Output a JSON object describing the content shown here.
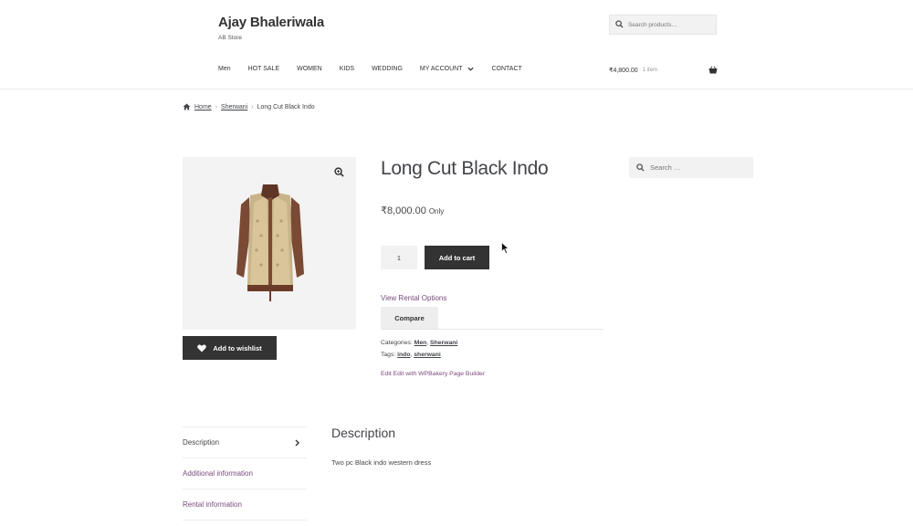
{
  "site": {
    "title": "Ajay Bhaleriwala",
    "tagline": "AB Store"
  },
  "header_search": {
    "placeholder": "Search products…"
  },
  "nav": {
    "items": [
      {
        "label": "Men"
      },
      {
        "label": "HOT SALE"
      },
      {
        "label": "WOMEN"
      },
      {
        "label": "KIDS"
      },
      {
        "label": "WEDDING"
      },
      {
        "label": "MY ACCOUNT"
      },
      {
        "label": "CONTACT"
      }
    ]
  },
  "cart": {
    "amount": "₹4,800.00",
    "count": "1 item"
  },
  "breadcrumb": {
    "home": "Home",
    "category": "Sherwani",
    "current": "Long Cut Black Indo"
  },
  "product": {
    "title": "Long Cut Black Indo",
    "price": "₹8,000.00",
    "price_suffix": "Only",
    "quantity": "1",
    "add_to_cart": "Add to cart",
    "rental_link": "View Rental Options",
    "compare": "Compare",
    "wishlist": "Add to wishlist",
    "categories_label": "Categories:",
    "categories": [
      "Men",
      "Sherwani"
    ],
    "tags_label": "Tags:",
    "tags": [
      "indo",
      "sherwani"
    ],
    "edit_link": "Edit Edit with WPBakery Page Builder"
  },
  "sidebar_search": {
    "placeholder": "Search …"
  },
  "tabs": {
    "items": [
      {
        "label": "Description"
      },
      {
        "label": "Additional information"
      },
      {
        "label": "Rental information"
      }
    ],
    "panel_title": "Description",
    "panel_text": "Two pc Black indo western dress"
  },
  "colors": {
    "accent_link": "#7b4a7e",
    "button_dark": "#333333",
    "text": "#43454b",
    "image_bg": "#f3f3f3"
  },
  "icons": [
    "search-icon",
    "chevron-down-icon",
    "basket-icon",
    "home-icon",
    "zoom-icon",
    "heart-icon",
    "chevron-right-icon",
    "cursor-icon"
  ]
}
